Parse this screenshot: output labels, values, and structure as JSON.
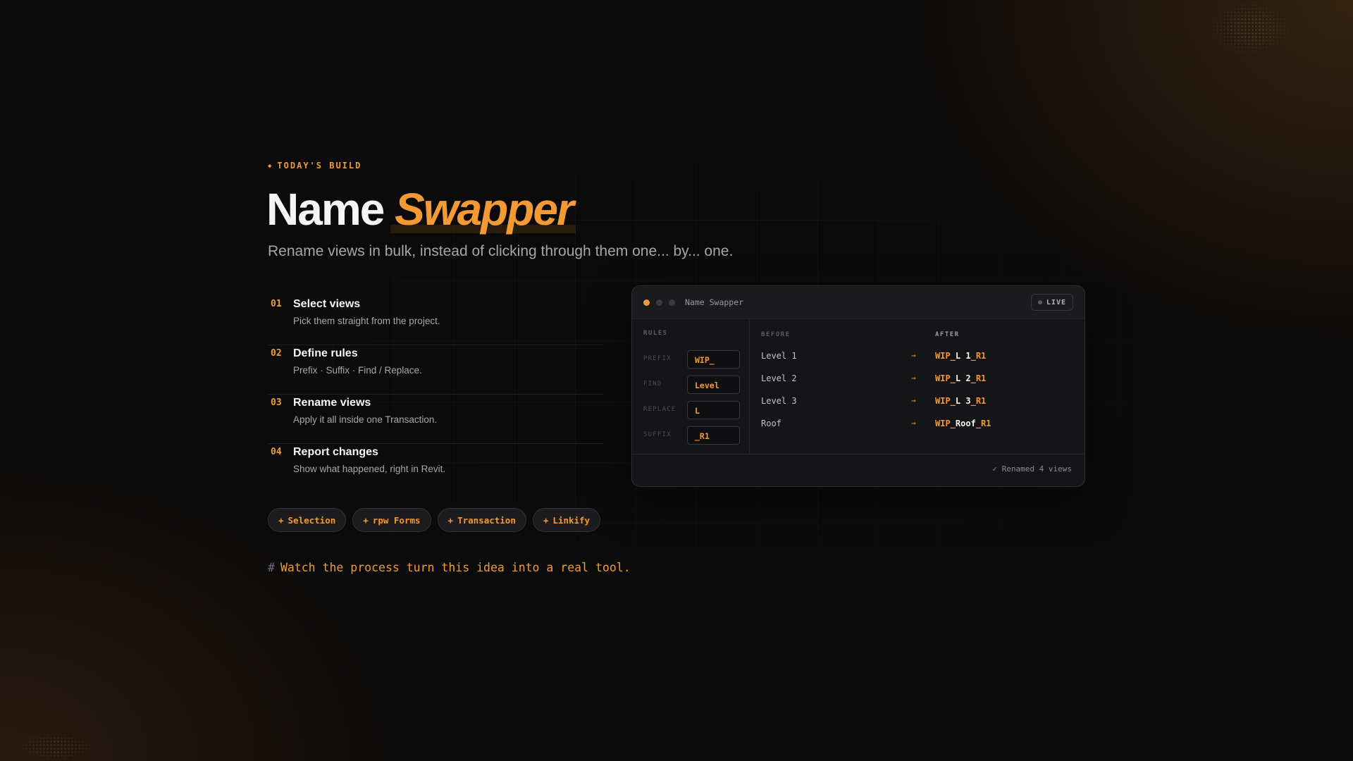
{
  "eyebrow": "TODAY'S BUILD",
  "title": {
    "main": "Name",
    "accent": "Swapper"
  },
  "subtitle": "Rename views in bulk, instead of clicking through them one... by... one.",
  "steps": [
    {
      "num": "01",
      "title": "Select views",
      "desc": "Pick them straight from the project."
    },
    {
      "num": "02",
      "title": "Define rules",
      "desc": "Prefix · Suffix · Find / Replace."
    },
    {
      "num": "03",
      "title": "Rename views",
      "desc": "Apply it all inside one Transaction."
    },
    {
      "num": "04",
      "title": "Report changes",
      "desc": "Show what happened, right in Revit."
    }
  ],
  "chips": [
    {
      "label": "Selection"
    },
    {
      "label": "rpw Forms"
    },
    {
      "label": "Transaction"
    },
    {
      "label": "Linkify"
    }
  ],
  "footer": {
    "hash": "#",
    "text": "Watch the process turn this idea into a real tool."
  },
  "window": {
    "title": "Name Swapper",
    "live_label": "LIVE",
    "rules_heading": "RULES",
    "rules": [
      {
        "label": "PREFIX",
        "value": "WIP_"
      },
      {
        "label": "FIND",
        "value": "Level"
      },
      {
        "label": "REPLACE",
        "value": "L"
      },
      {
        "label": "SUFFIX",
        "value": "_R1"
      }
    ],
    "before_heading": "BEFORE",
    "after_heading": "AFTER",
    "rows": [
      {
        "before": "Level 1",
        "after_prefix": "WIP_",
        "after_mid": "L 1",
        "after_suffix": "_R1"
      },
      {
        "before": "Level 2",
        "after_prefix": "WIP_",
        "after_mid": "L 2",
        "after_suffix": "_R1"
      },
      {
        "before": "Level 3",
        "after_prefix": "WIP_",
        "after_mid": "L 3",
        "after_suffix": "_R1"
      },
      {
        "before": "Roof",
        "after_prefix": "WIP_",
        "after_mid": "Roof",
        "after_suffix": "_R1"
      }
    ],
    "status": "✓ Renamed 4 views"
  },
  "colors": {
    "accent": "#f39a34",
    "background": "#0c0b0b",
    "panel": "#151517"
  },
  "icons": {
    "eyebrow": "diamond-icon",
    "chip": "plus-icon",
    "row_arrow": "arrow-right-icon",
    "status": "check-icon"
  }
}
